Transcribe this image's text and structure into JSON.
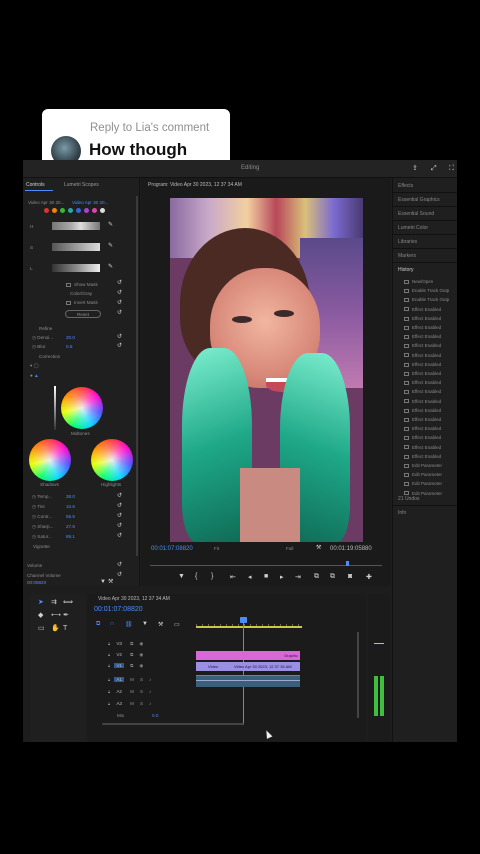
{
  "comment_bubble": {
    "reply_label": "Reply to Lia's comment",
    "comment_text": "How though"
  },
  "topbar": {
    "tab_editing": "Editing"
  },
  "left_panel": {
    "tab_controls": "Controls",
    "tab_scopes": "Lumetri Scopes",
    "clip_label": "Video Apr 30 20...",
    "clip_label_b": "Video Apr 30 20...",
    "show_mask": "Show Mask",
    "color_gray": "Color/Gray",
    "invert_mask": "Invert Mask",
    "reset": "Reset",
    "refine": "Refine",
    "denoise": "Denoi...",
    "denoise_val": "20.0",
    "blur": "Blur",
    "blur_val": "0.6",
    "correction": "Correction",
    "midtones": "Midtones",
    "shadows": "Shadows",
    "highlights": "Highlights",
    "temp": "Temp...",
    "temp_val": "38.0",
    "tint": "Tint",
    "tint_val": "10.6",
    "contrast": "Contr...",
    "contrast_val": "55.5",
    "sharp": "Sharp...",
    "sharp_val": "27.8",
    "satur": "Satur...",
    "satur_val": "89.1",
    "vignette": "Vignette",
    "volume": "Volume",
    "channel_volume": "Channel Volume",
    "timecode": "00:08820"
  },
  "program": {
    "title": "Program: Video Apr 30 2023, 12 37 34 AM",
    "timecode_current": "00:01:07:08820",
    "fit": "Fit",
    "full": "Full",
    "timecode_duration": "00:01:19:05880"
  },
  "right_panel": {
    "effects": "Effects",
    "essential_graphics": "Essential Graphics",
    "essential_sound": "Essential Sound",
    "lumetri_color": "Lumetri Color",
    "libraries": "Libraries",
    "markers": "Markers",
    "history": "History",
    "history_items": [
      "New/Open",
      "Enable Track Outp",
      "Enable Track Outp",
      "Effect Enabled",
      "Effect Enabled",
      "Effect Enabled",
      "Effect Enabled",
      "Effect Enabled",
      "Effect Enabled",
      "Effect Enabled",
      "Effect Enabled",
      "Effect Enabled",
      "Effect Enabled",
      "Effect Enabled",
      "Effect Enabled",
      "Effect Enabled",
      "Effect Enabled",
      "Effect Enabled",
      "Effect Enabled",
      "Effect Enabled",
      "Edit Parameter",
      "Edit Parameter",
      "Edit Parameter",
      "Edit Parameter"
    ],
    "undos": "21 Undos",
    "info": "Info"
  },
  "timeline": {
    "title": "Video Apr 30 2023, 12 37 34 AM",
    "timecode": "00:01:07:08820",
    "graphic_label": "Graphic",
    "video_label": "Video",
    "video_clip_label": "Video Apr 30 2023, 12 37 34 AM",
    "mix_label": "Mix",
    "mix_val": "0.0",
    "tracks": [
      "V3",
      "V2",
      "V1",
      "A1",
      "A2",
      "A3"
    ]
  },
  "colors": {
    "accent_blue": "#4d8cff",
    "graphic_clip": "#d867d8",
    "video_clip": "#9a8fe0",
    "audio_clip": "#3b5f7a",
    "meter_green": "#3fbf3f"
  }
}
